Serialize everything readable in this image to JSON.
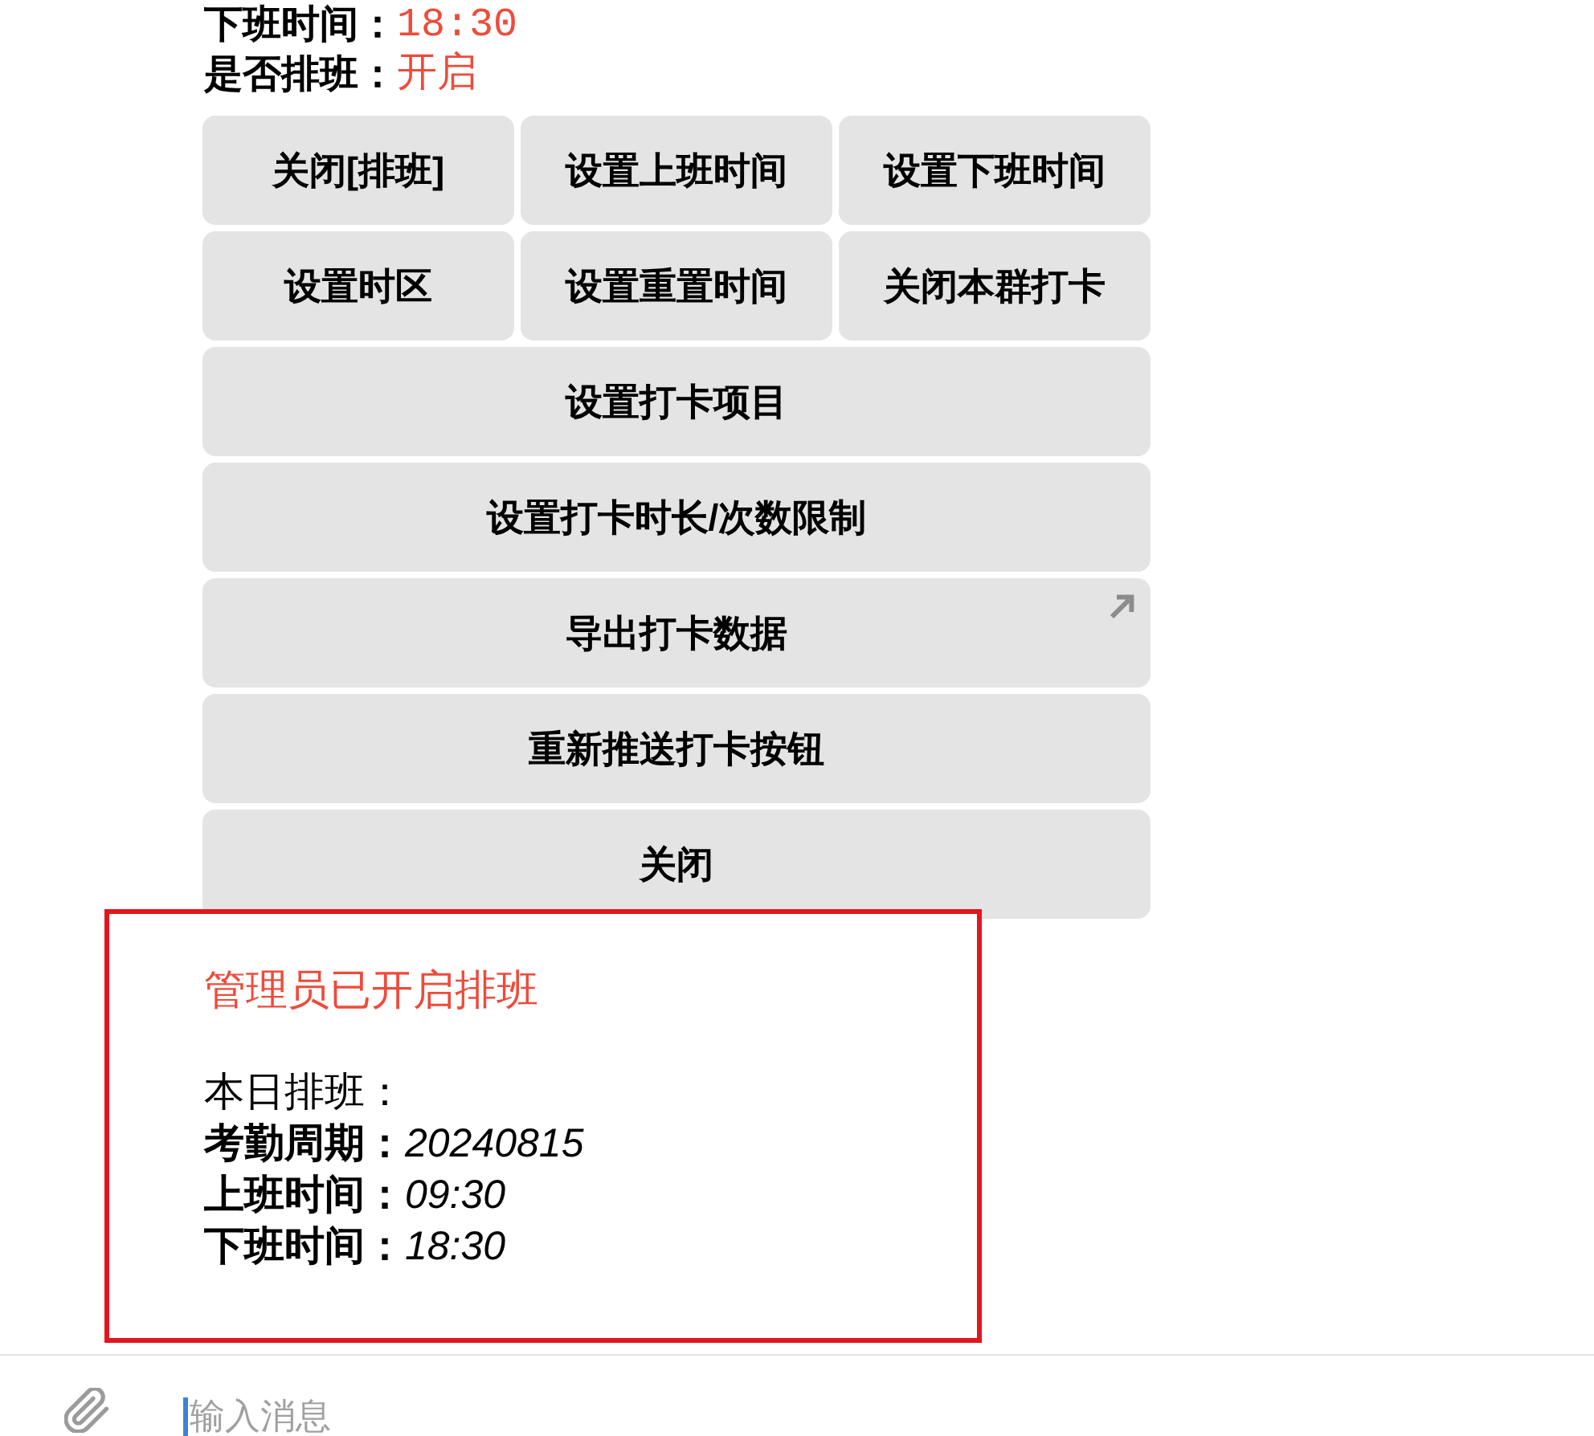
{
  "summary": [
    {
      "label": "下班时间：",
      "value": "18:30"
    },
    {
      "label": "是否排班：",
      "value": "开启"
    }
  ],
  "keyboard": [
    {
      "buttons": [
        {
          "label": "关闭[排班]",
          "kind": "callback"
        },
        {
          "label": "设置上班时间",
          "kind": "callback"
        },
        {
          "label": "设置下班时间",
          "kind": "callback"
        }
      ]
    },
    {
      "buttons": [
        {
          "label": "设置时区",
          "kind": "callback"
        },
        {
          "label": "设置重置时间",
          "kind": "callback"
        },
        {
          "label": "关闭本群打卡",
          "kind": "callback"
        }
      ]
    },
    {
      "buttons": [
        {
          "label": "设置打卡项目",
          "kind": "callback"
        }
      ]
    },
    {
      "buttons": [
        {
          "label": "设置打卡时长/次数限制",
          "kind": "callback"
        }
      ]
    },
    {
      "buttons": [
        {
          "label": "导出打卡数据",
          "kind": "url"
        }
      ]
    },
    {
      "buttons": [
        {
          "label": "重新推送打卡按钮",
          "kind": "callback"
        }
      ]
    },
    {
      "buttons": [
        {
          "label": "关闭",
          "kind": "callback"
        }
      ]
    }
  ],
  "message": {
    "highlighted": true,
    "title": "管理员已开启排班",
    "lines": [
      {
        "kind": "heading",
        "text": "本日排班："
      },
      {
        "kind": "field",
        "label": "考勤周期：",
        "value": "20240815"
      },
      {
        "kind": "field",
        "label": "上班时间：",
        "value": "09:30"
      },
      {
        "kind": "field",
        "label": "下班时间：",
        "value": "18:30"
      }
    ]
  },
  "composer": {
    "placeholder": "输入消息",
    "focused": true
  }
}
